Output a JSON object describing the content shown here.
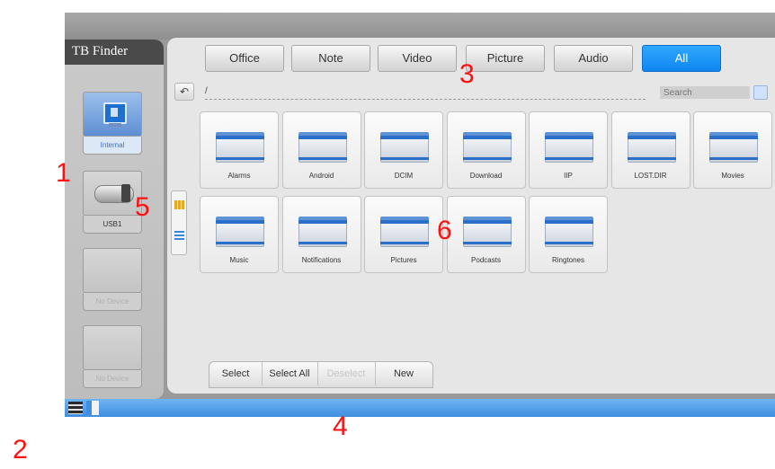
{
  "sidebar": {
    "title": "TB Finder",
    "devices": [
      {
        "label": "Internal",
        "icon": "monitor-icon",
        "state": "selected"
      },
      {
        "label": "USB1",
        "icon": "usb-drive-icon",
        "state": "available"
      },
      {
        "label": "No Device",
        "icon": "",
        "state": "empty"
      },
      {
        "label": "No Device",
        "icon": "",
        "state": "empty"
      }
    ]
  },
  "tabs": [
    {
      "label": "Office"
    },
    {
      "label": "Note"
    },
    {
      "label": "Video"
    },
    {
      "label": "Picture"
    },
    {
      "label": "Audio"
    },
    {
      "label": "All",
      "active": true
    }
  ],
  "path": {
    "text": "/",
    "back_icon": "back-arrow-icon"
  },
  "search": {
    "placeholder": "Search",
    "icon": "search-icon"
  },
  "view_toggle": {
    "grid_icon": "grid-view-icon",
    "list_icon": "list-view-icon",
    "active": "grid"
  },
  "folders": [
    {
      "name": "Alarms"
    },
    {
      "name": "Android"
    },
    {
      "name": "DCIM"
    },
    {
      "name": "Download"
    },
    {
      "name": "IIP"
    },
    {
      "name": "LOST.DIR"
    },
    {
      "name": "Movies"
    },
    {
      "name": "Music"
    },
    {
      "name": "Notifications"
    },
    {
      "name": "Pictures"
    },
    {
      "name": "Podcasts"
    },
    {
      "name": "Ringtones"
    }
  ],
  "bottom_actions": [
    {
      "label": "Select",
      "enabled": true
    },
    {
      "label": "Select All",
      "enabled": true
    },
    {
      "label": "Deselect",
      "enabled": false
    },
    {
      "label": "New",
      "enabled": true
    }
  ],
  "statusbar": {
    "icons": [
      "menu-icon",
      "window-icon"
    ]
  },
  "callouts": [
    "1",
    "2",
    "3",
    "4",
    "5",
    "6"
  ],
  "colors": {
    "accent": "#1a96f8",
    "callout": "#ff1111",
    "statusbar": "#4a98e6"
  }
}
